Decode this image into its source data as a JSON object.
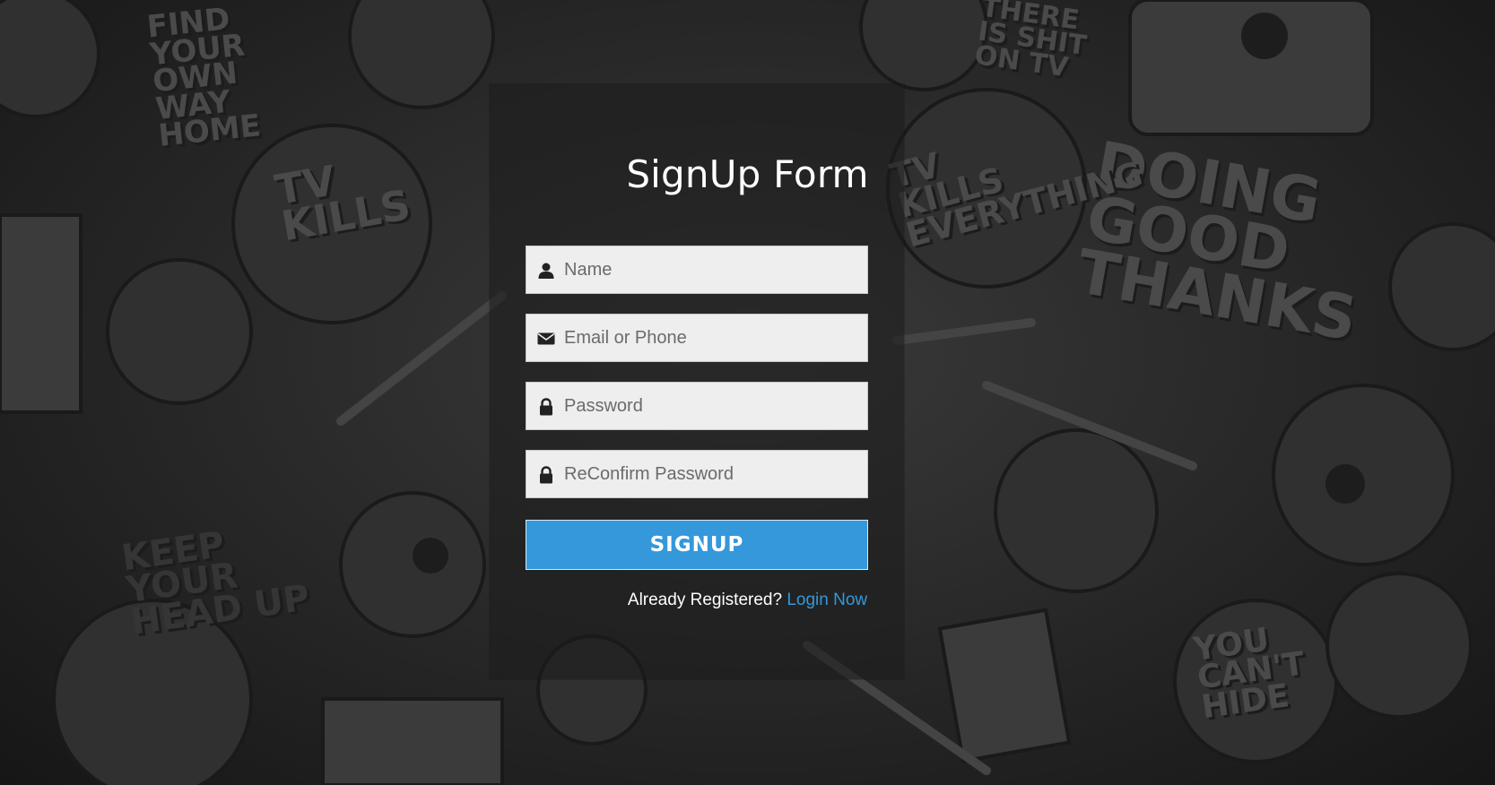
{
  "background": {
    "texts": [
      "FIND YOUR OWN WAY HOME",
      "THERE IS SHIT ON TV",
      "TV KILLS",
      "DOING GOOD THANKS",
      "KEEP YOUR HEAD UP",
      "YOU CAN'T HIDE",
      "TV KILLS EVERYTHING"
    ]
  },
  "form": {
    "title": "SignUp Form",
    "fields": [
      {
        "icon": "user-icon",
        "placeholder": "Name",
        "value": ""
      },
      {
        "icon": "envelope-icon",
        "placeholder": "Email or Phone",
        "value": ""
      },
      {
        "icon": "lock-icon",
        "placeholder": "Password",
        "value": ""
      },
      {
        "icon": "lock-icon",
        "placeholder": "ReConfirm Password",
        "value": ""
      }
    ],
    "submit_label": "SIGNUP",
    "footer_text": "Already Registered?",
    "login_link": "Login Now"
  },
  "colors": {
    "accent": "#3498db",
    "field_bg": "#eeeeee",
    "panel_bg": "rgba(28,28,28,0.55)"
  }
}
